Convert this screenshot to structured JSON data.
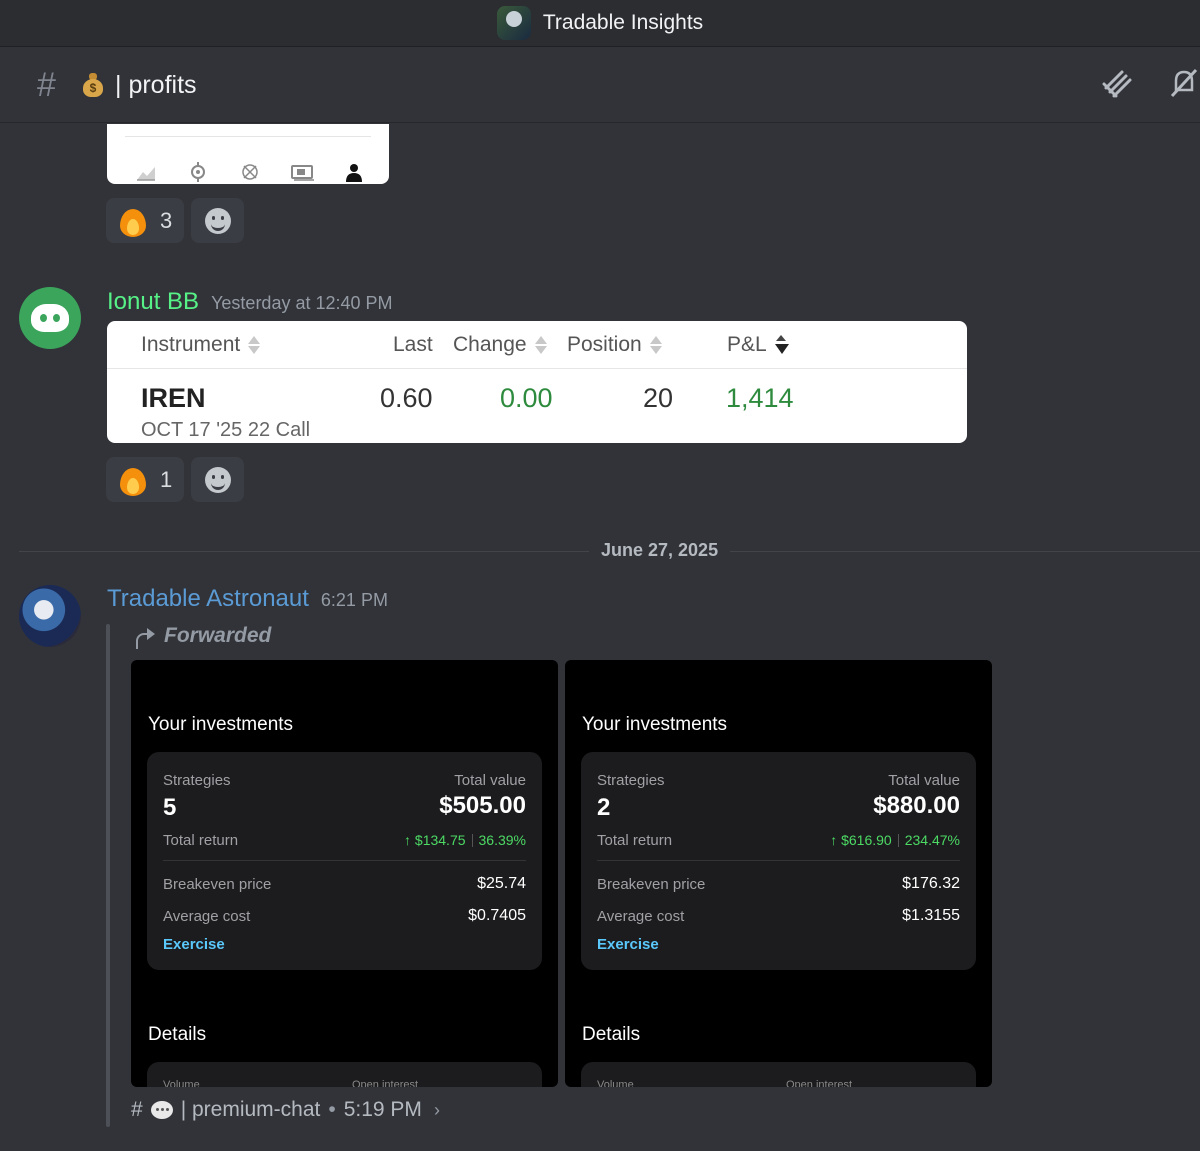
{
  "server": {
    "title": "Tradable Insights"
  },
  "channel": {
    "hash": "#",
    "bag_glyph": "$",
    "name": "| profits"
  },
  "reactions_1": {
    "count": "3"
  },
  "msg1": {
    "author": "Ionut BB",
    "author_color": "#57f287",
    "timestamp": "Yesterday at 12:40 PM",
    "table": {
      "headers": {
        "instrument": "Instrument",
        "last": "Last",
        "change": "Change",
        "position": "Position",
        "pnl": "P&L"
      },
      "row": {
        "symbol": "IREN",
        "contract": "OCT 17 '25 22 Call",
        "last": "0.60",
        "change": "0.00",
        "position": "20",
        "pnl": "1,414"
      }
    }
  },
  "reactions_2": {
    "count": "1"
  },
  "date_divider": "June 27, 2025",
  "msg2": {
    "author": "Tradable Astronaut",
    "author_color": "#5b9bd5",
    "timestamp": "6:21 PM",
    "forwarded_label": "Forwarded",
    "cards": [
      {
        "heading": "Your investments",
        "strategies_label": "Strategies",
        "strategies": "5",
        "total_value_label": "Total value",
        "total_value": "$505.00",
        "total_return_label": "Total return",
        "return_amount": "↑ $134.75",
        "return_pct": "36.39%",
        "breakeven_label": "Breakeven price",
        "breakeven": "$25.74",
        "avg_cost_label": "Average cost",
        "avg_cost": "$0.7405",
        "exercise": "Exercise",
        "details": "Details",
        "volume_label": "Volume",
        "open_interest_label": "Open interest"
      },
      {
        "heading": "Your investments",
        "strategies_label": "Strategies",
        "strategies": "2",
        "total_value_label": "Total value",
        "total_value": "$880.00",
        "total_return_label": "Total return",
        "return_amount": "↑ $616.90",
        "return_pct": "234.47%",
        "breakeven_label": "Breakeven price",
        "breakeven": "$176.32",
        "avg_cost_label": "Average cost",
        "avg_cost": "$1.3155",
        "exercise": "Exercise",
        "details": "Details",
        "volume_label": "Volume",
        "open_interest_label": "Open interest"
      }
    ],
    "context": {
      "hash": "#",
      "channel": "| premium-chat",
      "dot": "•",
      "time": "5:19 PM",
      "chevron": "›"
    }
  },
  "icons": {
    "top_right": [
      "threads-icon",
      "notifications-muted-icon"
    ],
    "nav": [
      "chart-icon",
      "discover-icon",
      "options-icon",
      "cash-icon",
      "profile-icon"
    ]
  }
}
